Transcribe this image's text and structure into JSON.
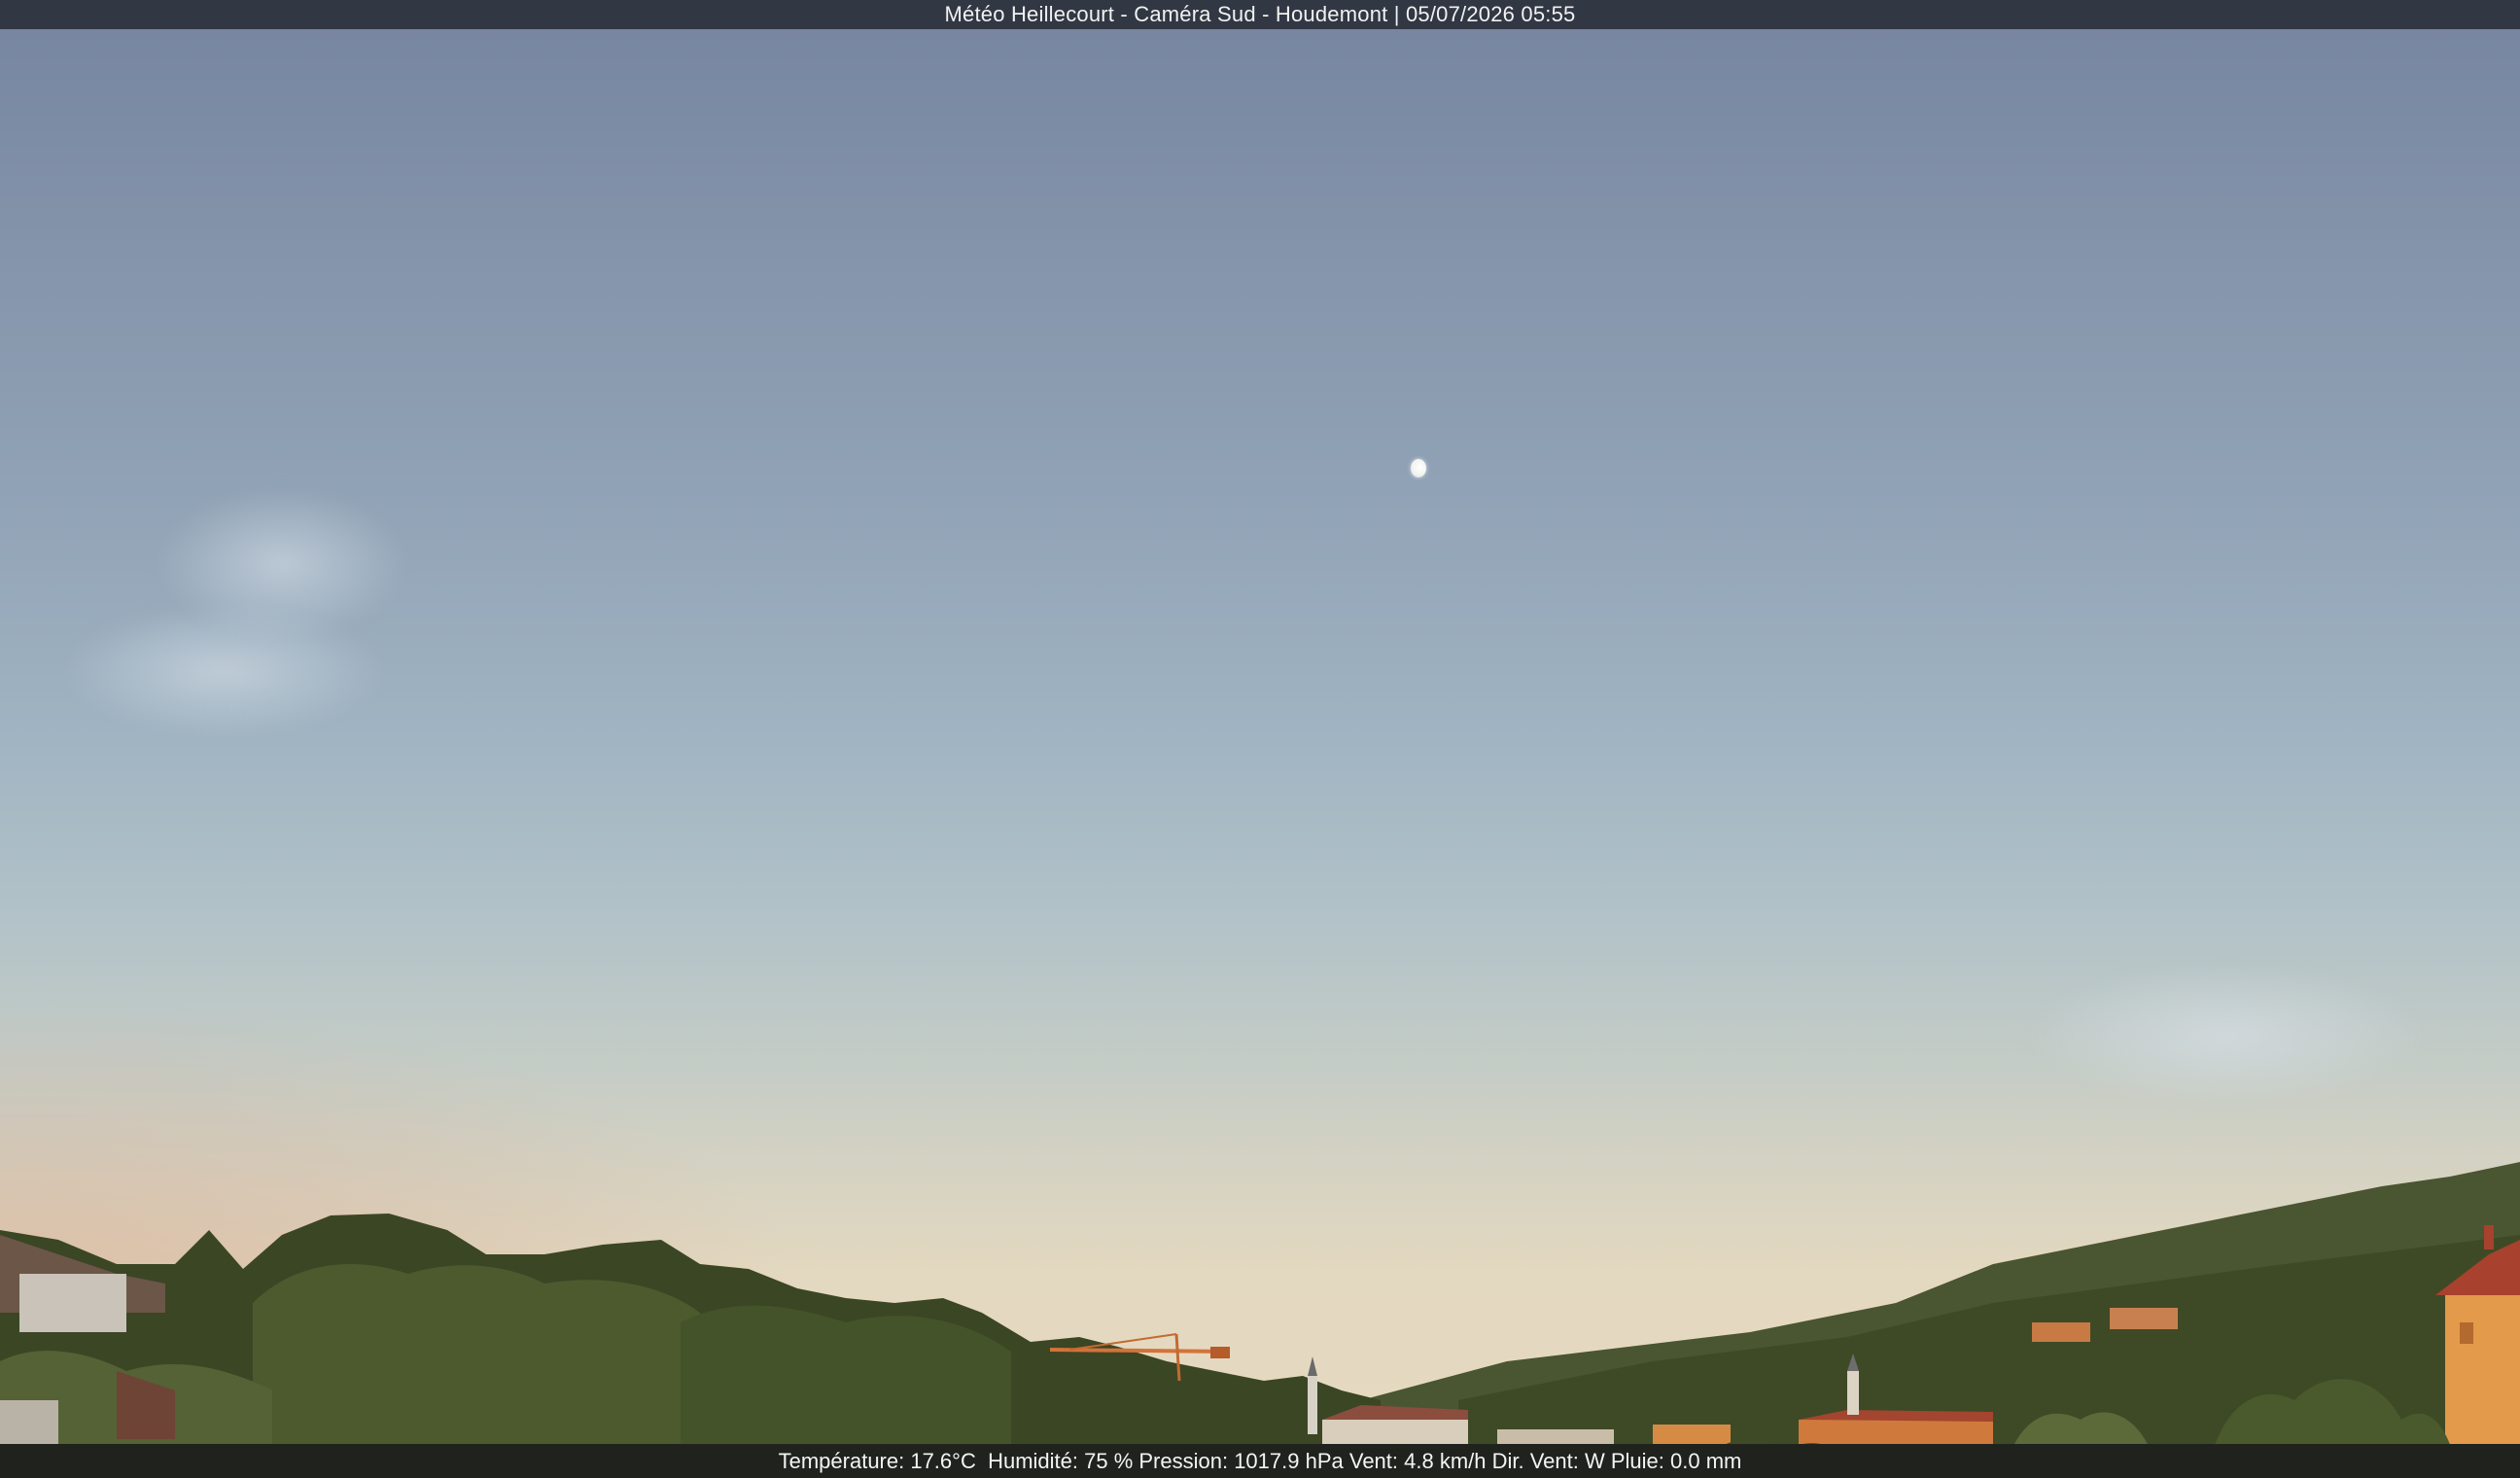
{
  "header": {
    "title": "Météo Heillecourt - Caméra Sud - Houdemont | 05/07/2026 05:55"
  },
  "weather": {
    "temperature": "Température: 17.6°C  ",
    "humidity": "Humidité: 75 % ",
    "pressure": "Pression: 1017.9 hPa ",
    "wind_speed": "Vent: 4.8 km/h ",
    "wind_direction": "Dir. Vent: W ",
    "rain": "Pluie: 0.0 mm"
  },
  "colors": {
    "sky_top": "#7684a0",
    "sky_horizon": "#e3d8c0",
    "trees": "#3d4a26",
    "lit_facade": "#e39a4a"
  }
}
